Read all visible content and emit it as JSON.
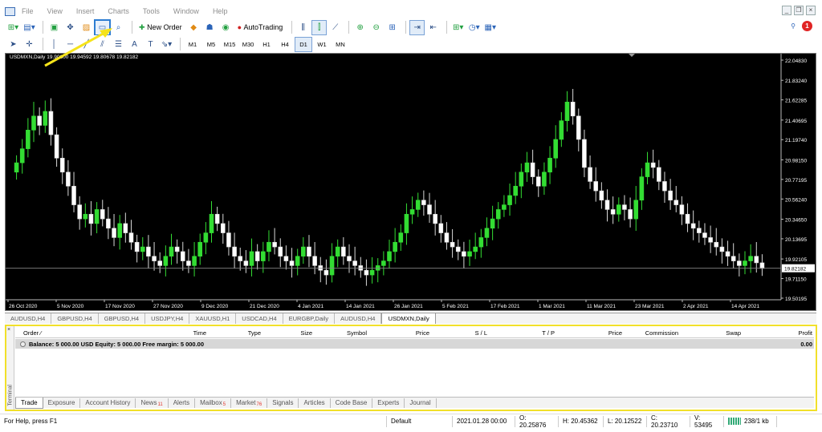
{
  "menu": [
    "File",
    "View",
    "Insert",
    "Charts",
    "Tools",
    "Window",
    "Help"
  ],
  "toolbar": {
    "new_order": "New Order",
    "autotrading": "AutoTrading",
    "timeframes": [
      "M1",
      "M5",
      "M15",
      "M30",
      "H1",
      "H4",
      "D1",
      "W1",
      "MN"
    ],
    "active_timeframe": "D1",
    "notification_count": "1"
  },
  "chart": {
    "info": "USDMXN,Daily  19.90800 19.94592 19.80678 19.82182",
    "current_price": "19.82182",
    "price_labels": [
      "22.04830",
      "21.83240",
      "21.62285",
      "21.40695",
      "21.19740",
      "20.98150",
      "20.77195",
      "20.56240",
      "20.34650",
      "20.13695",
      "19.92105",
      "19.71150",
      "19.50195"
    ],
    "date_labels": [
      "26 Oct 2020",
      "5 Nov 2020",
      "17 Nov 2020",
      "27 Nov 2020",
      "9 Dec 2020",
      "21 Dec 2020",
      "4 Jan 2021",
      "14 Jan 2021",
      "26 Jan 2021",
      "5 Feb 2021",
      "17 Feb 2021",
      "1 Mar 2021",
      "11 Mar 2021",
      "23 Mar 2021",
      "2 Apr 2021",
      "14 Apr 2021"
    ],
    "colors": {
      "background": "#000000",
      "bull": "#33dd33",
      "bear": "#ffffff",
      "grid_line": "#888888"
    }
  },
  "chart_data": {
    "type": "candlestick",
    "symbol": "USDMXN",
    "timeframe": "Daily",
    "ylim": [
      19.50195,
      22.0483
    ],
    "last": 19.82182,
    "closes": [
      20.95,
      21.1,
      21.3,
      21.45,
      21.35,
      21.5,
      21.25,
      21.0,
      20.85,
      20.7,
      20.5,
      20.35,
      20.4,
      20.3,
      20.45,
      20.35,
      20.25,
      20.15,
      20.3,
      20.2,
      20.1,
      20.0,
      20.05,
      19.95,
      19.9,
      19.85,
      19.95,
      20.05,
      20.0,
      19.9,
      19.85,
      19.95,
      20.1,
      20.2,
      20.4,
      20.3,
      20.2,
      20.05,
      19.95,
      19.9,
      19.85,
      20.0,
      19.9,
      20.0,
      20.1,
      20.05,
      19.95,
      19.9,
      19.85,
      19.95,
      20.05,
      19.95,
      19.85,
      19.8,
      19.75,
      19.95,
      20.05,
      19.95,
      19.9,
      19.85,
      19.8,
      19.75,
      19.8,
      19.85,
      19.9,
      20.0,
      20.1,
      20.2,
      20.4,
      20.45,
      20.55,
      20.5,
      20.4,
      20.3,
      20.2,
      20.1,
      20.05,
      20.0,
      19.95,
      20.0,
      20.05,
      20.15,
      20.25,
      20.35,
      20.45,
      20.5,
      20.6,
      20.7,
      20.85,
      20.95,
      20.8,
      20.7,
      20.85,
      21.0,
      21.2,
      21.4,
      21.6,
      21.45,
      21.2,
      20.9,
      20.75,
      20.65,
      20.55,
      20.45,
      20.4,
      20.5,
      20.45,
      20.35,
      20.55,
      20.8,
      20.95,
      20.9,
      20.75,
      20.65,
      20.55,
      20.5,
      20.4,
      20.3,
      20.25,
      20.2,
      20.15,
      20.1,
      20.05,
      20.0,
      19.95,
      19.9,
      19.85,
      19.9,
      19.95,
      19.88,
      19.82
    ]
  },
  "chart_tabs": [
    "AUDUSD,H4",
    "GBPUSD,H4",
    "GBPUSD,H4",
    "USDJPY,H4",
    "XAUUSD,H1",
    "USDCAD,H4",
    "EURGBP,Daily",
    "AUDUSD,H4",
    "USDMXN,Daily"
  ],
  "active_chart_tab": "USDMXN,Daily",
  "terminal": {
    "side_label": "Terminal",
    "columns": [
      "Order",
      "Time",
      "Type",
      "Size",
      "Symbol",
      "Price",
      "S / L",
      "T / P",
      "Price",
      "Commission",
      "Swap",
      "Profit"
    ],
    "balance_text": "Balance: 5 000.00 USD  Equity: 5 000.00  Free margin: 5 000.00",
    "balance_profit": "0.00",
    "tabs": [
      {
        "label": "Trade",
        "count": ""
      },
      {
        "label": "Exposure",
        "count": ""
      },
      {
        "label": "Account History",
        "count": ""
      },
      {
        "label": "News",
        "count": "11"
      },
      {
        "label": "Alerts",
        "count": ""
      },
      {
        "label": "Mailbox",
        "count": "5"
      },
      {
        "label": "Market",
        "count": "76"
      },
      {
        "label": "Signals",
        "count": ""
      },
      {
        "label": "Articles",
        "count": ""
      },
      {
        "label": "Code Base",
        "count": ""
      },
      {
        "label": "Experts",
        "count": ""
      },
      {
        "label": "Journal",
        "count": ""
      }
    ],
    "active_tab": "Trade"
  },
  "status": {
    "help": "For Help, press F1",
    "profile": "Default",
    "datetime": "2021.01.28 00:00",
    "open": "O: 20.25876",
    "high": "H: 20.45362",
    "low": "L: 20.12522",
    "close": "C: 20.23710",
    "volume": "V: 53495",
    "traffic": "238/1 kb"
  }
}
